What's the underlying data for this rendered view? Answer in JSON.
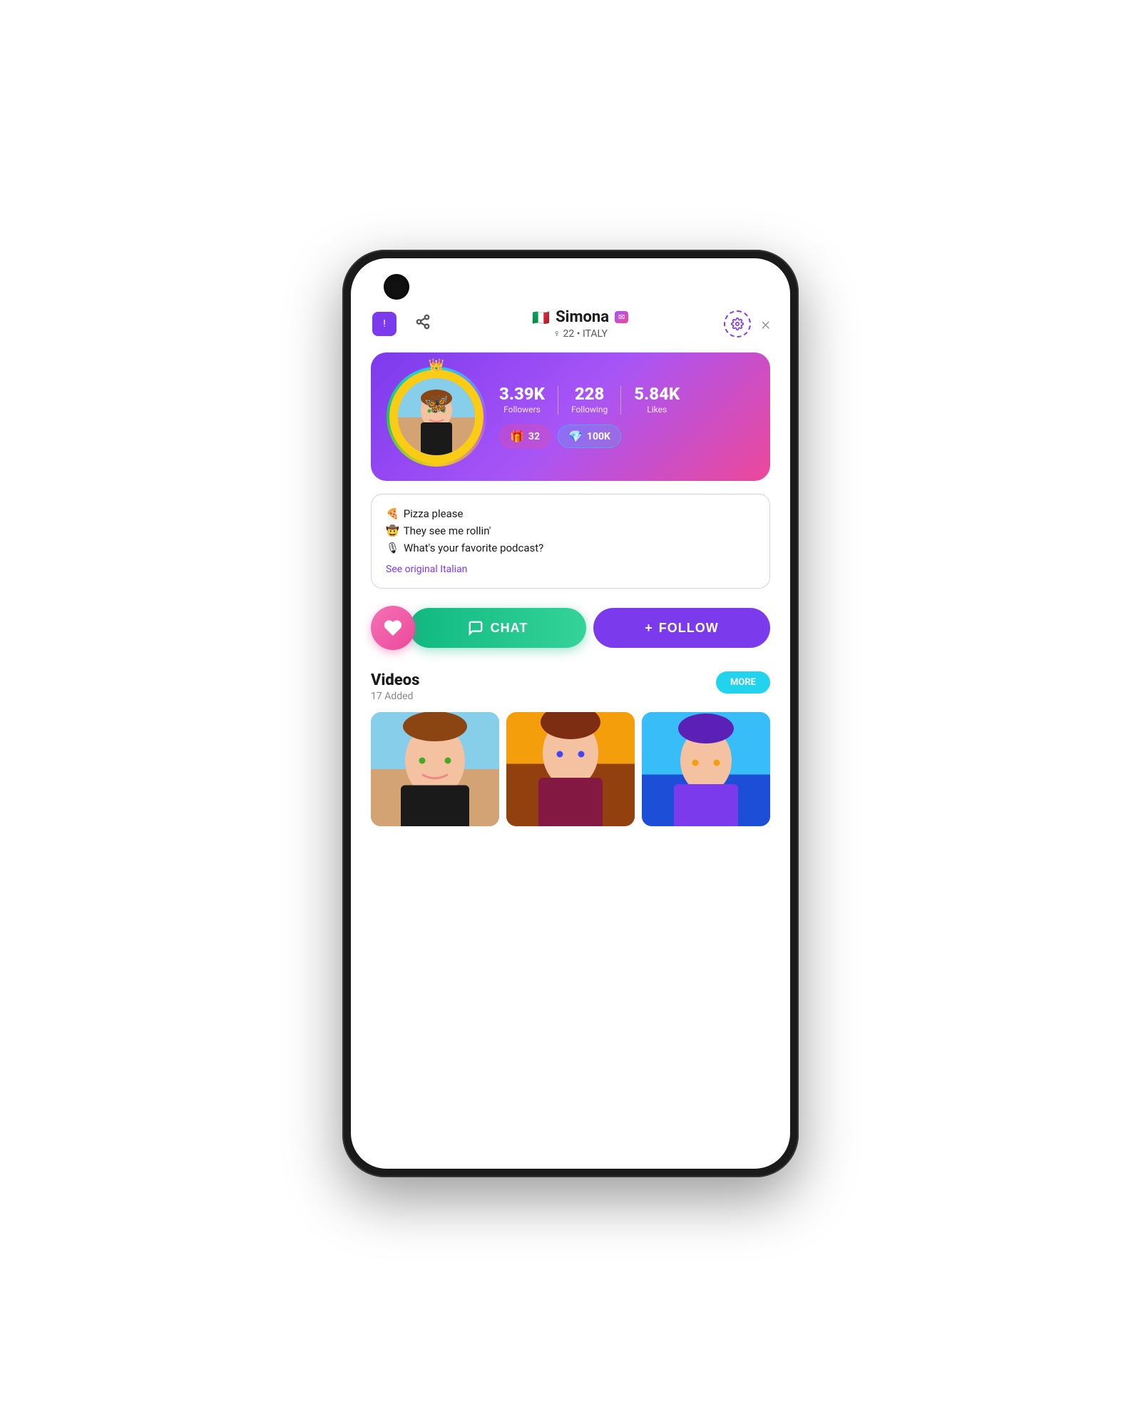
{
  "phone": {
    "header": {
      "flag": "🇮🇹",
      "name": "Simona",
      "verified_badge": "✉",
      "gender_symbol": "♀",
      "age": "22",
      "country": "ITALY",
      "shield_icon": "!",
      "share_icon": "⋮",
      "settings_icon": "⚙",
      "close_icon": "×"
    },
    "stats": {
      "followers_value": "3.39K",
      "followers_label": "Followers",
      "following_value": "228",
      "following_label": "Following",
      "likes_value": "5.84K",
      "likes_label": "Likes",
      "gifts_count": "32",
      "diamonds_count": "100K"
    },
    "bio": {
      "line1_emoji": "🍕",
      "line1_text": "Pizza please",
      "line2_emoji": "🤠",
      "line2_text": "They see me rollin'",
      "line3_emoji": "🎙",
      "line3_text": "What's your favorite podcast?",
      "see_original_label": "See original Italian"
    },
    "actions": {
      "like_icon": "♡",
      "chat_label": "CHAT",
      "chat_icon": "○",
      "follow_label": "FOLLOW",
      "follow_icon": "+"
    },
    "videos": {
      "title": "Videos",
      "count": "17 Added",
      "more_label": "MORE"
    }
  }
}
